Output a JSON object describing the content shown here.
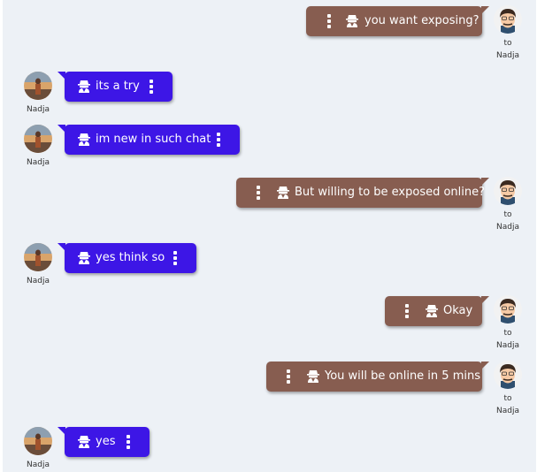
{
  "contact": {
    "name": "Nadja",
    "to_label": "to"
  },
  "colors": {
    "incoming_bubble": "#3d16e6",
    "outgoing_bubble": "#875d50",
    "background": "#edf1f6"
  },
  "icons": {
    "message_type": "spy-icon",
    "menu": "more-vertical-icon"
  },
  "messages": [
    {
      "direction": "outgoing",
      "text": "you want exposing?"
    },
    {
      "direction": "incoming",
      "text": "its a try"
    },
    {
      "direction": "incoming",
      "text": "im new in such chat"
    },
    {
      "direction": "outgoing",
      "text": "But willing to be exposed online?"
    },
    {
      "direction": "incoming",
      "text": "yes think so"
    },
    {
      "direction": "outgoing",
      "text": "Okay"
    },
    {
      "direction": "outgoing",
      "text": "You will be online in 5 mins"
    },
    {
      "direction": "incoming",
      "text": "yes"
    }
  ]
}
